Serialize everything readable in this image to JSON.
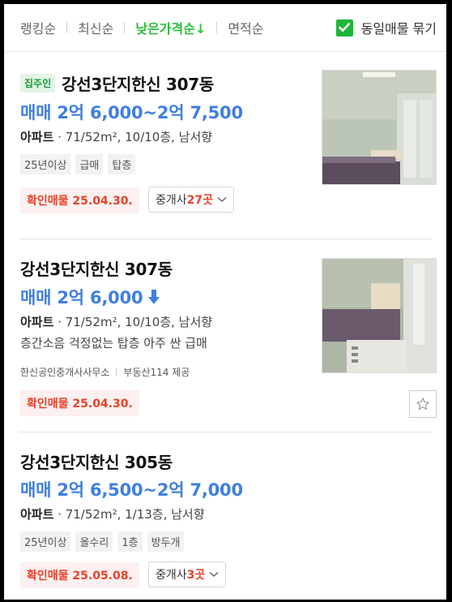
{
  "sort": {
    "items": [
      {
        "label": "랭킹순",
        "active": false
      },
      {
        "label": "최신순",
        "active": false
      },
      {
        "label": "낮은가격순↓",
        "active": true
      },
      {
        "label": "면적순",
        "active": false
      }
    ],
    "group_label": "동일매물 묶기",
    "group_checked": true
  },
  "listings": [
    {
      "badge": "집주인",
      "title": "강선3단지한신 307동",
      "price": "매매 2억 6,000~2억 7,500",
      "spec_type": "아파트",
      "spec_detail": "· 71/52m², 10/10층, 남서향",
      "tags": [
        "25년이상",
        "급매",
        "탑층"
      ],
      "verified": "확인매물 25.04.30.",
      "agents_label": "중개사 ",
      "agents_count": "27곳"
    },
    {
      "title": "강선3단지한신 307동",
      "price": "매매 2억 6,000",
      "spec_type": "아파트",
      "spec_detail": "· 71/52m², 10/10층, 남서향",
      "description": "층간소음 걱정없는 탑층 아주 싼 급매",
      "source_agent": "한신공인중개사사무소",
      "source_provider": "부동산114 제공",
      "verified": "확인매물 25.04.30."
    },
    {
      "title": "강선3단지한신 305동",
      "price": "매매 2억 6,500~2억 7,000",
      "spec_type": "아파트",
      "spec_detail": "· 71/52m², 1/13층, 남서향",
      "tags": [
        "25년이상",
        "올수리",
        "1층",
        "방두개"
      ],
      "verified": "확인매물 25.05.08.",
      "agents_label": "중개사 ",
      "agents_count": "3곳"
    }
  ],
  "icons": {
    "check": "check-icon",
    "chevron": "chevron-down-icon",
    "star": "star-icon",
    "arrow_down": "price-down-arrow-icon"
  },
  "colors": {
    "accent_green": "#2dbd3a",
    "price_blue": "#3f7fe0",
    "verify_red": "#e5432b"
  }
}
